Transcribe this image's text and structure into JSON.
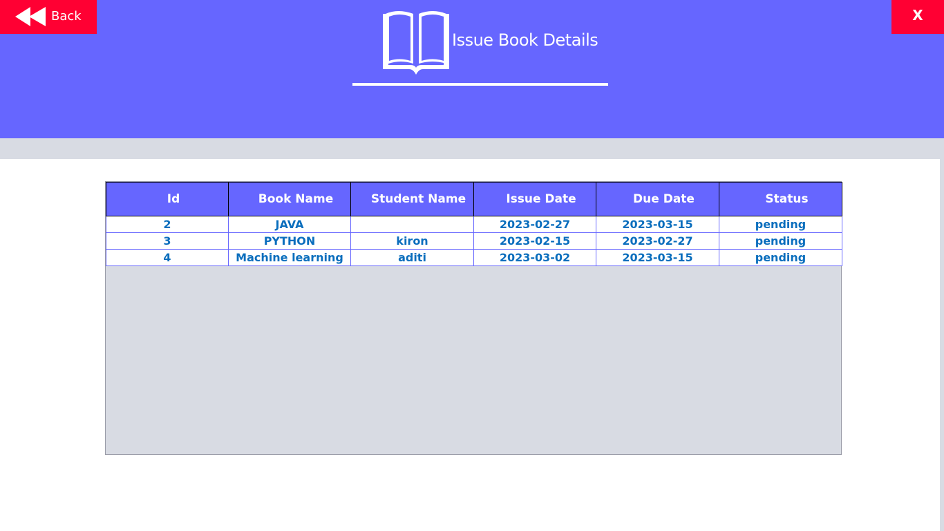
{
  "header": {
    "back_label": "Back",
    "close_label": "X",
    "title": "Issue Book Details"
  },
  "colors": {
    "header_bg": "#6666ff",
    "button_bg": "#ff0033",
    "cell_text": "#0a6ebd",
    "empty_area": "#d8dbe3"
  },
  "table": {
    "columns": [
      "Id",
      "Book Name",
      "Student Name",
      "Issue Date",
      "Due Date",
      "Status"
    ],
    "rows": [
      [
        "2",
        "JAVA",
        "",
        "2023-02-27",
        "2023-03-15",
        "pending"
      ],
      [
        "3",
        "PYTHON",
        "kiron",
        "2023-02-15",
        "2023-02-27",
        "pending"
      ],
      [
        "4",
        "Machine learning",
        "aditi",
        "2023-03-02",
        "2023-03-15",
        "pending"
      ]
    ]
  }
}
